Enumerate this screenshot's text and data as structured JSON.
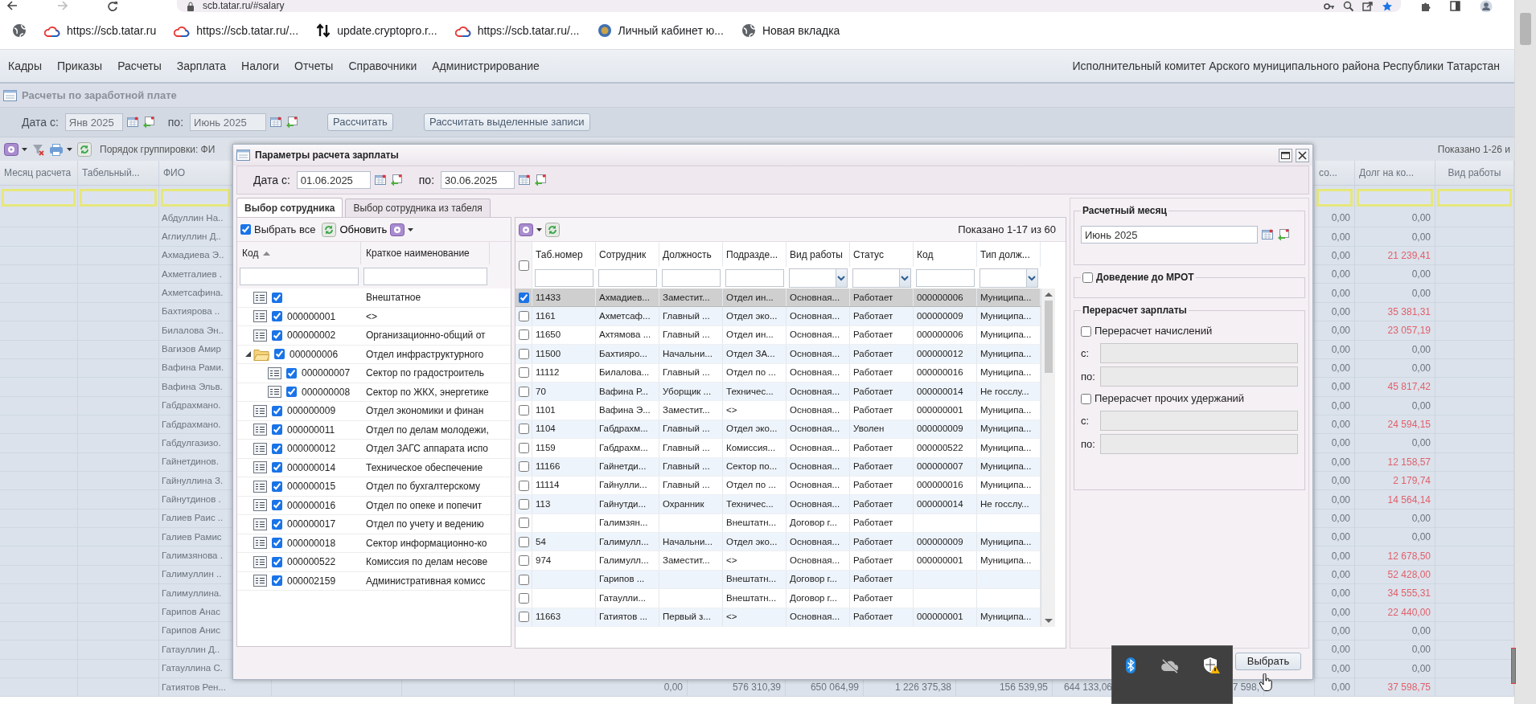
{
  "browser": {
    "url": "scb.tatar.ru/#salary",
    "bookmarks": [
      {
        "kind": "globe"
      },
      {
        "kind": "cloud",
        "label": "https://scb.tatar.ru"
      },
      {
        "kind": "cloud",
        "label": "https://scb.tatar.ru/..."
      },
      {
        "kind": "arrows",
        "label": "update.cryptopro.r..."
      },
      {
        "kind": "cloud",
        "label": "https://scb.tatar.ru/..."
      },
      {
        "kind": "emblem",
        "label": "Личный кабинет ю..."
      },
      {
        "kind": "globe",
        "label": "Новая вкладка"
      }
    ]
  },
  "menu": {
    "items": [
      "Кадры",
      "Приказы",
      "Расчеты",
      "Зарплата",
      "Налоги",
      "Отчеты",
      "Справочники",
      "Администрирование"
    ],
    "organization": "Исполнительный комитет Арского муниципального района Республики Татарстан"
  },
  "panel": {
    "title": "Расчеты по заработной плате",
    "date_from_label": "Дата с:",
    "date_from": "Янв 2025",
    "date_to_label": "по:",
    "date_to": "Июнь 2025",
    "buttons": [
      "Рассчитать",
      "Рассчитать выделенные записи"
    ]
  },
  "grid": {
    "grouping": "Порядок группировки: ФИ",
    "paging": "Показано 1-26 и",
    "columns": [
      "Месяц расчета",
      "Табельный...",
      "ФИО",
      "со...",
      "Долг на ко...",
      "Вид работы"
    ],
    "rows": [
      {
        "fio": "Абдуллин На..",
        "so": "0,00",
        "debt": "0,00",
        "debt_red": false
      },
      {
        "fio": "Аглиуллин Д..",
        "so": "0,00",
        "debt": "0,00",
        "debt_red": false
      },
      {
        "fio": "Ахмадиева Э..",
        "so": "0,00",
        "debt": "21 239,41",
        "debt_red": true
      },
      {
        "fio": "Ахметгалиев .",
        "so": "0,00",
        "debt": "0,00",
        "debt_red": false
      },
      {
        "fio": "Ахметсафина.",
        "so": "0,00",
        "debt": "0,00",
        "debt_red": false
      },
      {
        "fio": "Бахтиярова ..",
        "so": "0,00",
        "debt": "35 381,31",
        "debt_red": true
      },
      {
        "fio": "Билалова Эн..",
        "so": "0,00",
        "debt": "23 057,19",
        "debt_red": true
      },
      {
        "fio": "Вагизов Амир",
        "so": "0,00",
        "debt": "0,00",
        "debt_red": false
      },
      {
        "fio": "Вафина Рами.",
        "so": "0,00",
        "debt": "0,00",
        "debt_red": false
      },
      {
        "fio": "Вафина Эльв.",
        "so": "0,00",
        "debt": "45 817,42",
        "debt_red": true
      },
      {
        "fio": "Габдрахмано.",
        "so": "0,00",
        "debt": "0,00",
        "debt_red": false
      },
      {
        "fio": "Габдрахмано.",
        "so": "0,00",
        "debt": "24 594,15",
        "debt_red": true
      },
      {
        "fio": "Габдулгазизо.",
        "so": "0,00",
        "debt": "0,00",
        "debt_red": false
      },
      {
        "fio": "Гайнетдинов.",
        "so": "0,00",
        "debt": "12 158,57",
        "debt_red": true
      },
      {
        "fio": "Гайнуллина З.",
        "so": "0,00",
        "debt": "2 179,74",
        "debt_red": true
      },
      {
        "fio": "Гайнутдинов .",
        "so": "0,00",
        "debt": "14 564,14",
        "debt_red": true
      },
      {
        "fio": "Галиев Раис ..",
        "so": "0,00",
        "debt": "0,00",
        "debt_red": false
      },
      {
        "fio": "Галиев Рамис",
        "so": "0,00",
        "debt": "0,00",
        "debt_red": false
      },
      {
        "fio": "Галимзянова .",
        "so": "0,00",
        "debt": "12 678,50",
        "debt_red": true
      },
      {
        "fio": "Галимуллин ..",
        "so": "0,00",
        "debt": "52 428,00",
        "debt_red": true
      },
      {
        "fio": "Галимуллина.",
        "so": "0,00",
        "debt": "34 555,31",
        "debt_red": true
      },
      {
        "fio": "Гарипов Анас",
        "so": "0,00",
        "debt": "22 440,00",
        "debt_red": true
      },
      {
        "fio": "Гарипов Анис",
        "so": "0,00",
        "debt": "0,00",
        "debt_red": false
      },
      {
        "fio": "Гатауллин Д..",
        "so": "0,00",
        "debt": "0,00",
        "debt_red": false
      },
      {
        "fio": "Гатауллина С.",
        "so": "0,00",
        "debt": "0,00",
        "debt_red": false
      },
      {
        "fio": "Гатиятов Рен...",
        "so": "0,00",
        "debt": "37 598,75",
        "debt_red": true,
        "values": [
          "0,00",
          "576 310,39",
          "650 064,99",
          "1 226 375,38",
          "156 539,95",
          "644 133,06",
          "7 598,"
        ]
      }
    ]
  },
  "dialog": {
    "title": "Параметры расчета зарплаты",
    "date_from_label": "Дата с:",
    "date_from": "01.06.2025",
    "date_to_label": "по:",
    "date_to": "30.06.2025",
    "tabs": [
      {
        "label": "Выбор сотрудника",
        "selected": true
      },
      {
        "label": "Выбор сотрудника из табеля",
        "selected": false
      }
    ],
    "tree": {
      "select_all": {
        "label": "Выбрать все",
        "checked": true
      },
      "refresh": "Обновить",
      "columns": [
        {
          "label": "Код",
          "sorted": true
        },
        {
          "label": "Краткое наименование",
          "sorted": false
        }
      ],
      "nodes": [
        {
          "kind": "leaf",
          "checked": true,
          "name": "Внештатное"
        },
        {
          "kind": "leaf",
          "checked": true,
          "code": "000000001",
          "name": "<>"
        },
        {
          "kind": "leaf",
          "checked": true,
          "code": "000000002",
          "name": "Организационно-общий от"
        },
        {
          "kind": "folder",
          "checked": true,
          "expanded": true,
          "code": "000000006",
          "name": "Отдел инфраструктурного",
          "children": [
            {
              "kind": "leaf",
              "checked": true,
              "code": "000000007",
              "name": "Сектор по градостроитель"
            },
            {
              "kind": "leaf",
              "checked": true,
              "code": "000000008",
              "name": "Сектор по ЖКХ, энергетике"
            }
          ]
        },
        {
          "kind": "leaf",
          "checked": true,
          "code": "000000009",
          "name": "Отдел экономики и финан"
        },
        {
          "kind": "leaf",
          "checked": true,
          "code": "000000011",
          "name": "Отдел по делам молодежи,"
        },
        {
          "kind": "leaf",
          "checked": true,
          "code": "000000012",
          "name": "Отдел ЗАГС аппарата испо"
        },
        {
          "kind": "leaf",
          "checked": true,
          "code": "000000014",
          "name": "Техническое обеспечение"
        },
        {
          "kind": "leaf",
          "checked": true,
          "code": "000000015",
          "name": "Отдел по бухгалтерскому"
        },
        {
          "kind": "leaf",
          "checked": true,
          "code": "000000016",
          "name": "Отдел по опеке и попечит"
        },
        {
          "kind": "leaf",
          "checked": true,
          "code": "000000017",
          "name": "Отдел по учету и ведению"
        },
        {
          "kind": "leaf",
          "checked": true,
          "code": "000000018",
          "name": "Сектор информационно-ко"
        },
        {
          "kind": "leaf",
          "checked": true,
          "code": "000000522",
          "name": "Комиссия по делам несове"
        },
        {
          "kind": "leaf",
          "checked": true,
          "code": "000002159",
          "name": "Административная комисс"
        }
      ]
    },
    "employees": {
      "paging": "Показано 1-17 из 60",
      "select_all": {
        "checked": false
      },
      "columns": [
        {
          "label": "Таб.номер",
          "kind": "text"
        },
        {
          "label": "Сотрудник",
          "kind": "text"
        },
        {
          "label": "Должность",
          "kind": "text"
        },
        {
          "label": "Подразде...",
          "kind": "text"
        },
        {
          "label": "Вид работы",
          "kind": "select"
        },
        {
          "label": "Статус",
          "kind": "select"
        },
        {
          "label": "Код",
          "kind": "text"
        },
        {
          "label": "Тип долж...",
          "kind": "select"
        }
      ],
      "rows": [
        {
          "checked": true,
          "selected": true,
          "tab": "11433",
          "employee": "Ахмадиев...",
          "position": "Заместит...",
          "department": "Отдел ин...",
          "work_type": "Основная...",
          "status": "Работает",
          "code": "000000006",
          "post_type": "Муниципа..."
        },
        {
          "checked": false,
          "selected": false,
          "tab": "1161",
          "employee": "Ахметсаф...",
          "position": "Главный ...",
          "department": "Отдел эко...",
          "work_type": "Основная...",
          "status": "Работает",
          "code": "000000009",
          "post_type": "Муниципа..."
        },
        {
          "checked": false,
          "selected": false,
          "tab": "11650",
          "employee": "Ахтямова ...",
          "position": "Главный ...",
          "department": "Отдел ин...",
          "work_type": "Основная...",
          "status": "Работает",
          "code": "000000006",
          "post_type": "Муниципа..."
        },
        {
          "checked": false,
          "selected": false,
          "tab": "11500",
          "employee": "Бахтияро...",
          "position": "Начальни...",
          "department": "Отдел ЗА...",
          "work_type": "Основная...",
          "status": "Работает",
          "code": "000000012",
          "post_type": "Муниципа..."
        },
        {
          "checked": false,
          "selected": false,
          "tab": "11112",
          "employee": "Билалова...",
          "position": "Главный ...",
          "department": "Отдел по ...",
          "work_type": "Основная...",
          "status": "Работает",
          "code": "000000016",
          "post_type": "Муниципа..."
        },
        {
          "checked": false,
          "selected": false,
          "tab": "70",
          "employee": "Вафина Р...",
          "position": "Уборщик ...",
          "department": "Техничес...",
          "work_type": "Основная...",
          "status": "Работает",
          "code": "000000014",
          "post_type": "Не госслу..."
        },
        {
          "checked": false,
          "selected": false,
          "tab": "1101",
          "employee": "Вафина Э...",
          "position": "Заместит...",
          "department": "<>",
          "work_type": "Основная...",
          "status": "Работает",
          "code": "000000001",
          "post_type": "Муниципа..."
        },
        {
          "checked": false,
          "selected": false,
          "tab": "1104",
          "employee": "Габдрахм...",
          "position": "Главный ...",
          "department": "Отдел эко...",
          "work_type": "Основная...",
          "status": "Уволен",
          "code": "000000009",
          "post_type": "Муниципа..."
        },
        {
          "checked": false,
          "selected": false,
          "tab": "1159",
          "employee": "Габдрахм...",
          "position": "Главный ...",
          "department": "Комиссия...",
          "work_type": "Основная...",
          "status": "Работает",
          "code": "000000522",
          "post_type": "Муниципа..."
        },
        {
          "checked": false,
          "selected": false,
          "tab": "11166",
          "employee": "Гайнетди...",
          "position": "Главный ...",
          "department": "Сектор по...",
          "work_type": "Основная...",
          "status": "Работает",
          "code": "000000007",
          "post_type": "Муниципа..."
        },
        {
          "checked": false,
          "selected": false,
          "tab": "11114",
          "employee": "Гайнулли...",
          "position": "Главный ...",
          "department": "Отдел по ...",
          "work_type": "Основная...",
          "status": "Работает",
          "code": "000000016",
          "post_type": "Муниципа..."
        },
        {
          "checked": false,
          "selected": false,
          "tab": "113",
          "employee": "Гайнутди...",
          "position": "Охранник",
          "department": "Техничес...",
          "work_type": "Основная...",
          "status": "Работает",
          "code": "000000014",
          "post_type": "Не госслу..."
        },
        {
          "checked": false,
          "selected": false,
          "employee": "Галимзян...",
          "department": "Внештатн...",
          "work_type": "Договор г...",
          "status": "Работает"
        },
        {
          "checked": false,
          "selected": false,
          "tab": "54",
          "employee": "Галимулл...",
          "position": "Начальни...",
          "department": "Отдел эко...",
          "work_type": "Основная...",
          "status": "Работает",
          "code": "000000009",
          "post_type": "Муниципа..."
        },
        {
          "checked": false,
          "selected": false,
          "tab": "974",
          "employee": "Галимулл...",
          "position": "Заместит...",
          "department": "<>",
          "work_type": "Основная...",
          "status": "Работает",
          "code": "000000001",
          "post_type": "Муниципа..."
        },
        {
          "checked": false,
          "selected": false,
          "employee": "Гарипов ...",
          "department": "Внештатн...",
          "work_type": "Договор г...",
          "status": "Работает"
        },
        {
          "checked": false,
          "selected": false,
          "employee": "Гатаулли...",
          "department": "Внештатн...",
          "work_type": "Договор г...",
          "status": "Работает"
        },
        {
          "checked": false,
          "selected": false,
          "tab": "11663",
          "employee": "Гатиятов ...",
          "position": "Первый з...",
          "department": "<>",
          "work_type": "Основная...",
          "status": "Работает",
          "code": "000000001",
          "post_type": "Муниципа..."
        }
      ]
    },
    "settings": {
      "month_legend": "Расчетный месяц",
      "month": "Июнь 2025",
      "mrot": {
        "label": "Доведение до МРОТ",
        "checked": false
      },
      "recalc_legend": "Перерасчет зарплаты",
      "recalc": [
        {
          "label": "Перерасчет начислений",
          "checked": false,
          "from_label": "с:",
          "to_label": "по:"
        },
        {
          "label": "Перерасчет прочих удержаний",
          "checked": false,
          "from_label": "с:",
          "to_label": "по:"
        }
      ]
    },
    "buttons": [
      "Выбрать"
    ]
  }
}
